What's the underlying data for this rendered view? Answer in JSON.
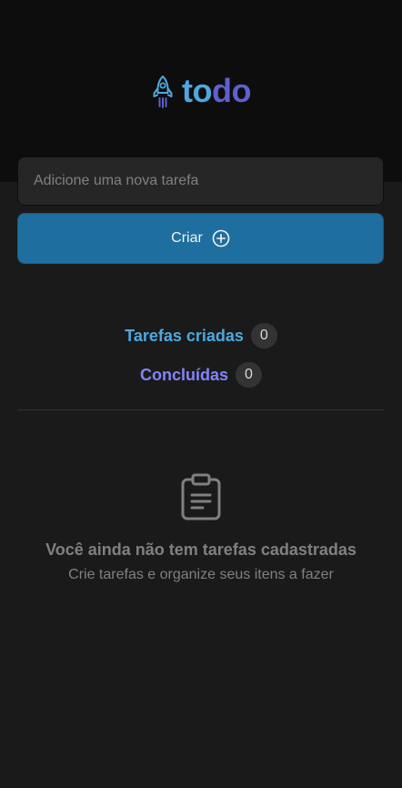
{
  "header": {
    "logo_part1": "to",
    "logo_part2": "do",
    "colors": {
      "accent_blue": "#4ea8de",
      "accent_purple": "#5e60ce"
    },
    "icon": "rocket-icon"
  },
  "form": {
    "input_placeholder": "Adicione uma nova tarefa",
    "input_value": "",
    "create_label": "Criar",
    "create_icon": "plus-circle-icon",
    "button_color": "#1e6f9f"
  },
  "counters": {
    "created_label": "Tarefas criadas",
    "created_count": "0",
    "done_label": "Concluídas",
    "done_count": "0"
  },
  "empty_state": {
    "icon": "clipboard-icon",
    "title": "Você ainda não tem tarefas cadastradas",
    "subtitle": "Crie tarefas e organize seus itens a fazer"
  }
}
